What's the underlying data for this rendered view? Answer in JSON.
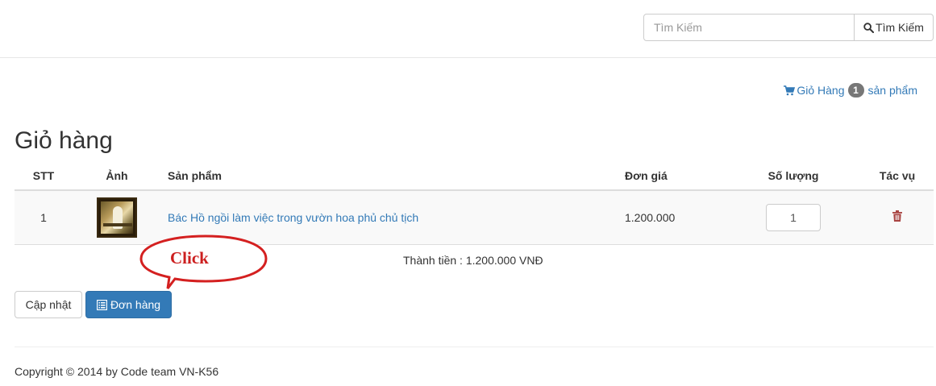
{
  "search": {
    "placeholder": "Tìm Kiếm",
    "button_label": "Tìm Kiếm"
  },
  "cart_summary": {
    "label": "Giỏ Hàng",
    "count": "1",
    "suffix": "sản phẩm"
  },
  "page_title": "Giỏ hàng",
  "table": {
    "headers": [
      "STT",
      "Ảnh",
      "Sản phẩm",
      "Đơn giá",
      "Số lượng",
      "Tác vụ"
    ],
    "rows": [
      {
        "stt": "1",
        "product": "Bác Hồ ngồi làm việc trong vườn hoa phủ chủ tịch",
        "price": "1.200.000",
        "quantity": "1"
      }
    ]
  },
  "total": "Thành tiền : 1.200.000 VNĐ",
  "annotation": "Click",
  "buttons": {
    "update": "Cập nhật",
    "order": "Đơn hàng"
  },
  "footer": "Copyright © 2014 by Code team VN-K56",
  "colors": {
    "link": "#337ab7",
    "primary": "#337ab7",
    "danger": "#a94442",
    "annotation": "#cc1f1f",
    "badge": "#777777"
  },
  "icons": {
    "search": "search-icon",
    "cart": "shopping-cart-icon",
    "trash": "trash-icon",
    "order": "list-alt-icon"
  }
}
